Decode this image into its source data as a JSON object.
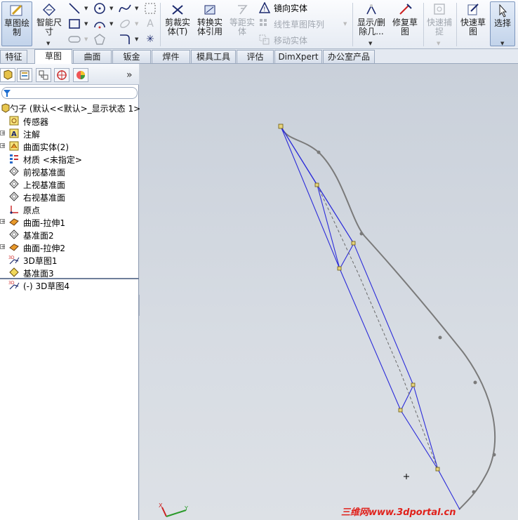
{
  "ribbon": {
    "sketch": "草图绘\n制",
    "smart_dim": "智能尺\n寸",
    "trim": "剪裁实\n体(T)",
    "convert": "转换实\n体引用",
    "offset": "等距实\n体",
    "mirror": "镜向实体",
    "linear_pattern": "线性草图阵列",
    "move": "移动实体",
    "show_hide": "显示/删\n除几...",
    "repair": "修复草\n图",
    "quick_snap": "快速捕\n捉",
    "rapid_sketch": "快速草\n图",
    "select": "选择"
  },
  "tabs": [
    "特征",
    "草图",
    "曲面",
    "钣金",
    "焊件",
    "模具工具",
    "评估",
    "DimXpert",
    "办公室产品"
  ],
  "active_tab": "草图",
  "tree": {
    "root": "勺子 (默认<<默认>_显示状态 1>)",
    "items": [
      {
        "label": "传感器",
        "expand": false,
        "icon": "sensor-icon"
      },
      {
        "label": "注解",
        "expand": true,
        "icon": "annotation-icon"
      },
      {
        "label": "曲面实体(2)",
        "expand": true,
        "icon": "surface-body-icon"
      },
      {
        "label": "材质 <未指定>",
        "expand": false,
        "icon": "material-icon"
      },
      {
        "label": "前视基准面",
        "expand": false,
        "icon": "plane-icon"
      },
      {
        "label": "上视基准面",
        "expand": false,
        "icon": "plane-icon"
      },
      {
        "label": "右视基准面",
        "expand": false,
        "icon": "plane-icon"
      },
      {
        "label": "原点",
        "expand": false,
        "icon": "origin-icon"
      },
      {
        "label": "曲面-拉伸1",
        "expand": true,
        "icon": "extrude-surface-icon"
      },
      {
        "label": "基准面2",
        "expand": false,
        "icon": "plane-icon"
      },
      {
        "label": "曲面-拉伸2",
        "expand": true,
        "icon": "extrude-surface-icon"
      },
      {
        "label": "3D草图1",
        "expand": false,
        "icon": "sketch3d-icon"
      },
      {
        "label": "基准面3",
        "expand": false,
        "icon": "plane-yellow-icon"
      },
      {
        "label": "(-) 3D草图4",
        "expand": false,
        "icon": "sketch3d-icon"
      }
    ]
  },
  "viewport": {
    "axis_x": "X",
    "axis_y": "Y",
    "watermark": "三维网www.3dportal.cn"
  },
  "colors": {
    "sketch_blue": "#2b2bd9",
    "curve_gray": "#7a7a7a",
    "point_yellow": "#e6d27a"
  }
}
